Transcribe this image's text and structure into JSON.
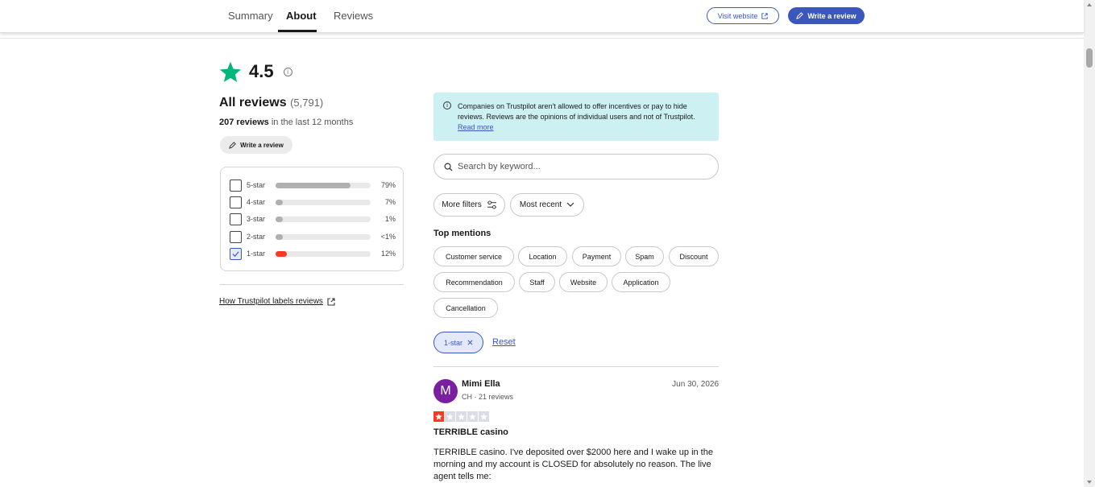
{
  "nav": {
    "tabs": [
      {
        "label": "Summary"
      },
      {
        "label": "About"
      },
      {
        "label": "Reviews"
      }
    ],
    "active_tab": "About",
    "visit_website": "Visit website",
    "write_review": "Write a review"
  },
  "summary": {
    "rating": "4.5",
    "all_reviews_label": "All reviews",
    "all_reviews_count": "(5,791)",
    "recent_count": "207 reviews",
    "recent_suffix": " in the last 12 months",
    "write_review": "Write a review"
  },
  "star_filters": [
    {
      "label": "5-star",
      "percent_text": "79%",
      "fill": 0.79,
      "checked": false,
      "color": "#b0b0b0"
    },
    {
      "label": "4-star",
      "percent_text": "7%",
      "fill": 0.07,
      "checked": false,
      "color": "#b0b0b0"
    },
    {
      "label": "3-star",
      "percent_text": "1%",
      "fill": 0.07,
      "checked": false,
      "color": "#b0b0b0"
    },
    {
      "label": "2-star",
      "percent_text": "<1%",
      "fill": 0.07,
      "checked": false,
      "color": "#b0b0b0"
    },
    {
      "label": "1-star",
      "percent_text": "12%",
      "fill": 0.12,
      "checked": true,
      "color": "#ff3722"
    }
  ],
  "how_labels_link": "How Trustpilot labels reviews",
  "notice": {
    "text": "Companies on Trustpilot aren't allowed to offer incentives or pay to hide reviews. Reviews are the opinions of individual users and not of Trustpilot. ",
    "link": "Read more"
  },
  "search": {
    "placeholder": "Search by keyword..."
  },
  "filters": {
    "more_filters": "More filters",
    "sort": "Most recent"
  },
  "top_mentions": {
    "heading": "Top mentions",
    "chips": [
      "Customer service",
      "Location",
      "Payment",
      "Spam",
      "Discount",
      "Recommendation",
      "Staff",
      "Website",
      "Application",
      "Cancellation"
    ]
  },
  "active_filter": {
    "label": "1-star",
    "reset": "Reset"
  },
  "review": {
    "avatar_letter": "M",
    "avatar_color": "#7b1fa2",
    "name": "Mimi Ella",
    "meta": "CH · 21 reviews",
    "date": "Jun 30, 2026",
    "stars": 1,
    "title": "TERRIBLE casino",
    "body": "TERRIBLE casino. I've deposited over $2000 here and I wake up in the morning and my account is CLOSED for absolutely no reason. The live agent tells me:"
  },
  "colors": {
    "brand_green": "#00b67a",
    "brand_blue": "#3c57bc",
    "one_star_red": "#ff3722",
    "notice_bg": "#cdf0f3"
  }
}
